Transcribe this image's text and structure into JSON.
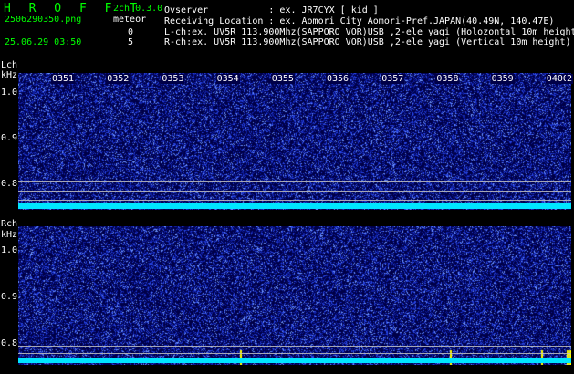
{
  "header": {
    "logo": "H R O F F T",
    "mode": "2ch 0.3.0",
    "filename": "2506290350.png",
    "meteor_label": "meteor",
    "datetime": "25.06.29 03:50",
    "count_l": "0",
    "count_r": "5",
    "observer_line": "Ovserver           : ex. JR7CYX [ kid ]",
    "location_line": "Receiving Location : ex. Aomori City Aomori-Pref.JAPAN(40.49N, 140.47E)",
    "lch_line": "L-ch:ex. UV5R 113.900Mhz(SAPPORO VOR)USB ,2-ele yagi (Holozontal 10m height",
    "rch_line": "R-ch:ex. UV5R 113.900Mhz(SAPPORO VOR)USB ,2-ele yagi (Vertical 10m height)"
  },
  "left_channel": {
    "label": "Lch",
    "unit": "kHz",
    "y_ticks": [
      "1.0",
      "0.9",
      "0.8"
    ]
  },
  "right_channel": {
    "label": "Rch",
    "unit": "kHz",
    "y_ticks": [
      "1.0",
      "0.9",
      "0.8"
    ]
  },
  "time_axis": [
    "0351",
    "0352",
    "0353",
    "0354",
    "0355",
    "0356",
    "0357",
    "0358",
    "0359",
    "0400",
    "2"
  ],
  "colors": {
    "background": "#000000",
    "spectrogram": "#000048",
    "noise": "#3a5cff",
    "baseline": "#00e5ff",
    "logo": "#00ff00",
    "meteor": "#ffff00"
  }
}
